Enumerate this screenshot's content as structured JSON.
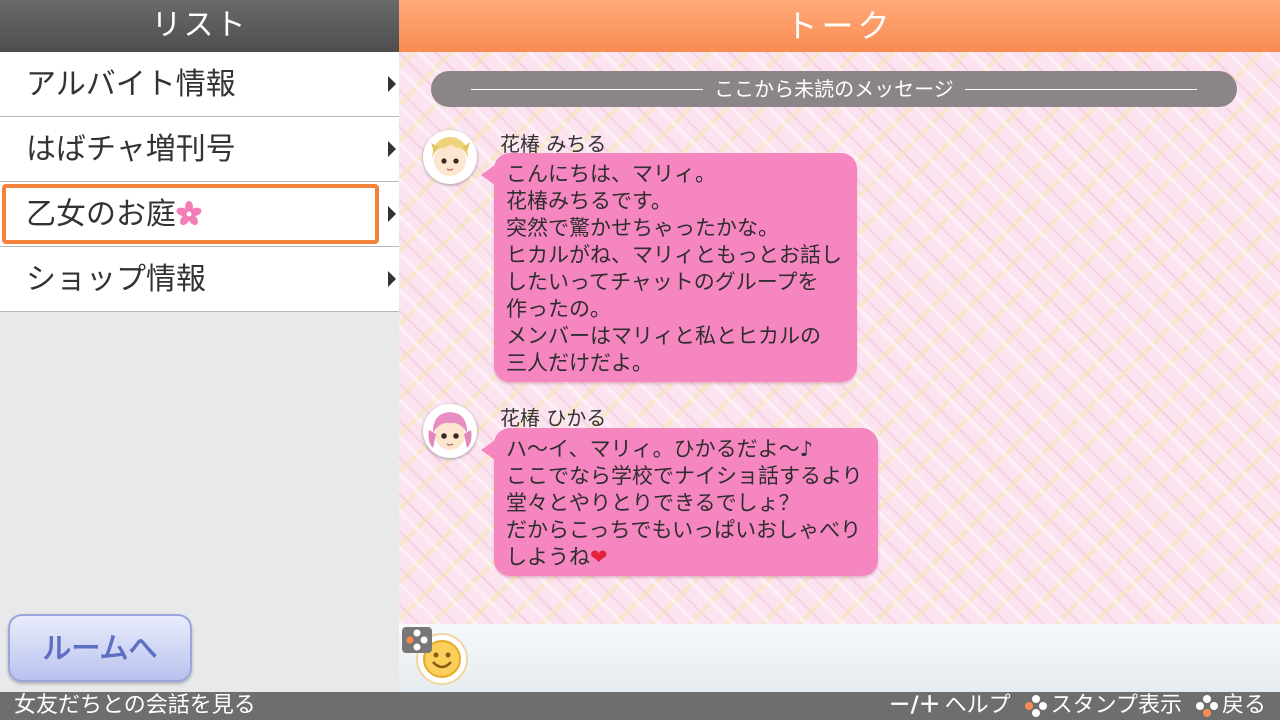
{
  "left_panel": {
    "title": "リスト",
    "menu": [
      {
        "label": "アルバイト情報"
      },
      {
        "label": "はばチャ増刊号"
      },
      {
        "label": "乙女のお庭",
        "selected": true,
        "icon": "flower-icon"
      },
      {
        "label": "ショップ情報"
      }
    ],
    "room_button": "ルームへ"
  },
  "right_panel": {
    "title": "トーク",
    "unread_divider": "ここから未読のメッセージ",
    "messages": [
      {
        "sender": "花椿 みちる",
        "lines": [
          "こんにちは、マリィ。",
          "花椿みちるです。",
          "突然で驚かせちゃったかな。",
          "ヒカルがね、マリィともっとお話し",
          "したいってチャットのグループを",
          "作ったの。",
          "メンバーはマリィと私とヒカルの",
          "三人だけだよ。"
        ]
      },
      {
        "sender": "花椿 ひかる",
        "lines": [
          "ハ～イ、マリィ。ひかるだよ～♪",
          "ここでなら学校でナイショ話するより",
          "堂々とやりとりできるでしょ？",
          "だからこっちでもいっぱいおしゃべり",
          "しようね"
        ],
        "end_emoji": "❤"
      }
    ]
  },
  "bottom_bar": {
    "hint": "女友だちとの会話を見る",
    "controls": [
      {
        "keys": "－/＋",
        "label": "ヘルプ"
      },
      {
        "label": "スタンプ表示",
        "icon": "dpad-left-icon"
      },
      {
        "label": "戻る",
        "icon": "dpad-down-icon"
      }
    ]
  },
  "colors": {
    "accent_orange": "#f98b52",
    "bubble_pink": "#f586c0",
    "room_button": "#5d6fc0"
  }
}
